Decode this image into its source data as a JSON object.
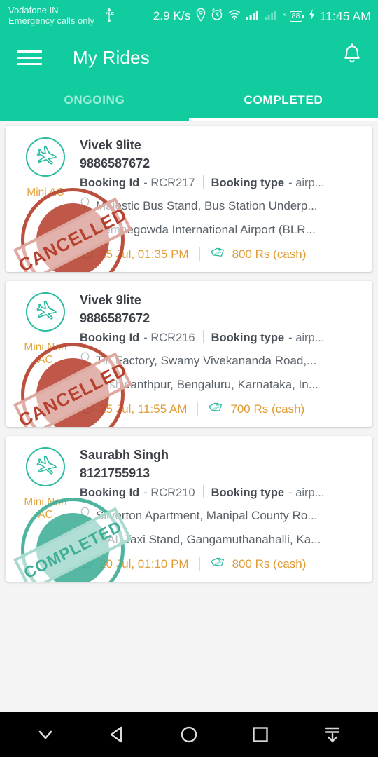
{
  "status_bar": {
    "carrier_line1": "Vodafone IN",
    "carrier_line2": "Emergency calls only",
    "usb_icon": "usb-icon",
    "net_speed": "2.9 K/s",
    "location_icon": "location-pin-icon",
    "alarm_icon": "alarm-clock-icon",
    "wifi_icon": "wifi-icon",
    "signal_icon": "signal-bars-icon",
    "signal2_icon": "signal-bars-no-sim-icon",
    "signal2_badge": "×",
    "battery_level": "88",
    "charging_icon": "charging-bolt-icon",
    "time": "11:45 AM"
  },
  "app_bar": {
    "menu_icon": "hamburger-menu-icon",
    "title": "My Rides",
    "notification_icon": "bell-icon"
  },
  "tabs": {
    "items": [
      {
        "label": "ONGOING",
        "active": false
      },
      {
        "label": "COMPLETED",
        "active": true
      }
    ]
  },
  "colors": {
    "brand_teal": "#10CC9F",
    "accent_orange": "#E09B33",
    "cancelled_red": "#B6412F",
    "completed_teal": "#3FAE96",
    "page_bg": "#F4F4F4",
    "card_bg": "#FFFFFF"
  },
  "rides": [
    {
      "vehicle_icon": "airplane-icon",
      "car_type": "Mini AC",
      "rider_name": "Vivek 9lite",
      "phone": "9886587672",
      "booking_id_label": "Booking Id",
      "booking_id_value": "- RCR217",
      "booking_type_label": "Booking type",
      "booking_type_value": "- airp...",
      "pickup": "Majestic Bus Stand, Bus Station Underp...",
      "drop": "Kempegowda International Airport (BLR...",
      "clock_icon": "clock-icon",
      "datetime": "25 Jul, 01:35 PM",
      "fare_icon": "fare-tag-icon",
      "fare": "800 Rs (cash)",
      "status_stamp": "CANCELLED",
      "stamp_style": "cancelled"
    },
    {
      "vehicle_icon": "airplane-icon",
      "car_type": "Mini Non AC",
      "rider_name": "Vivek 9lite",
      "phone": "9886587672",
      "booking_id_label": "Booking Id",
      "booking_id_value": "- RCR216",
      "booking_type_label": "Booking type",
      "booking_type_value": "- airp...",
      "pickup": "Tin Factory, Swamy Vivekananda Road,...",
      "drop": "Yeshwanthpur, Bengaluru, Karnataka, In...",
      "clock_icon": "clock-icon",
      "datetime": "25 Jul, 11:55 AM",
      "fare_icon": "fare-tag-icon",
      "fare": "700 Rs (cash)",
      "status_stamp": "CANCELLED",
      "stamp_style": "cancelled"
    },
    {
      "vehicle_icon": "airplane-icon",
      "car_type": "Mini Non AC",
      "rider_name": "Saurabh Singh",
      "phone": "8121755913",
      "booking_id_label": "Booking Id",
      "booking_id_value": "- RCR210",
      "booking_type_label": "Booking type",
      "booking_type_value": "- airp...",
      "pickup": "Silverton Apartment, Manipal County Ro...",
      "drop": "BIAL Taxi Stand, Gangamuthanahalli, Ka...",
      "clock_icon": "clock-icon",
      "datetime": "20 Jul, 01:10 PM",
      "fare_icon": "fare-tag-icon",
      "fare": "800 Rs (cash)",
      "status_stamp": "COMPLETED",
      "stamp_style": "completed"
    }
  ],
  "nav_bar": {
    "items": [
      {
        "icon": "chevron-down-icon"
      },
      {
        "icon": "back-triangle-icon"
      },
      {
        "icon": "home-circle-icon"
      },
      {
        "icon": "recents-square-icon"
      },
      {
        "icon": "hide-keyboard-icon"
      }
    ]
  }
}
